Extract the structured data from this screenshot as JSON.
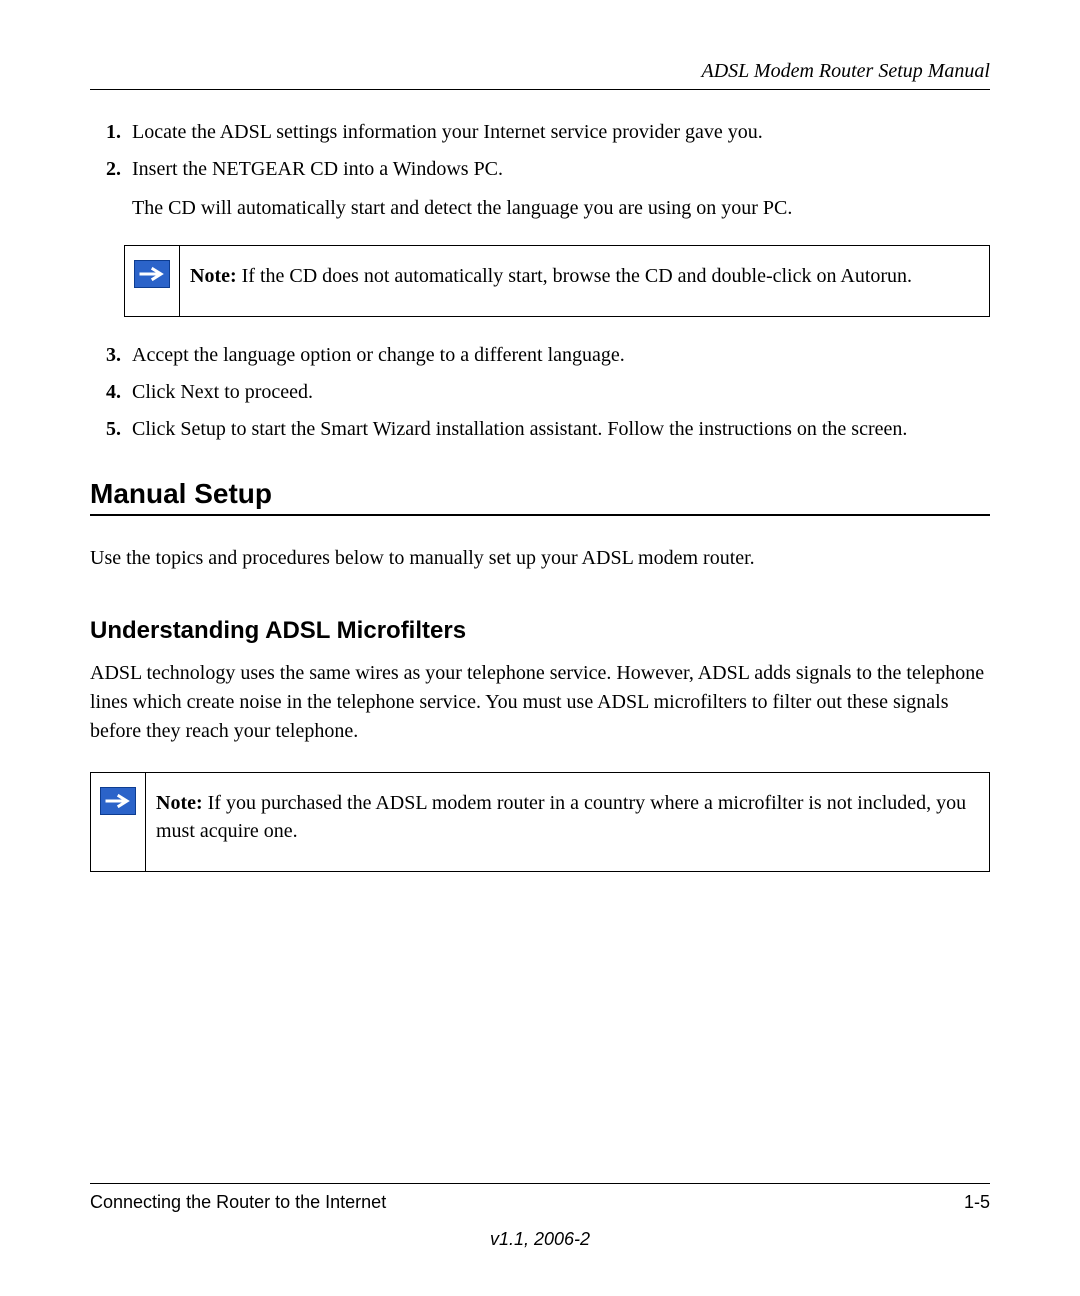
{
  "header": {
    "title": "ADSL Modem Router Setup Manual"
  },
  "steps_a": [
    {
      "num": "1.",
      "text": "Locate the ADSL settings information your Internet service provider gave you."
    },
    {
      "num": "2.",
      "text": "Insert the NETGEAR CD into a Windows PC.",
      "sub": "The CD will automatically start and detect the language you are using on your PC."
    }
  ],
  "note1": {
    "label": "Note: ",
    "text": "If the CD does not automatically start, browse the CD and double-click on Autorun."
  },
  "steps_b": [
    {
      "num": "3.",
      "text": "Accept the language option or change to a different language."
    },
    {
      "num": "4.",
      "text": "Click Next to proceed."
    },
    {
      "num": "5.",
      "text": "Click Setup to start the Smart Wizard installation assistant. Follow the instructions on the screen."
    }
  ],
  "section": {
    "title": "Manual Setup",
    "intro": "Use the topics and procedures below to manually set up your ADSL modem router."
  },
  "subsection": {
    "title": "Understanding ADSL Microfilters",
    "body": "ADSL technology uses the same wires as your telephone service. However, ADSL adds signals to the telephone lines which create noise in the telephone service. You must use ADSL microfilters to filter out these signals before they reach your telephone."
  },
  "note2": {
    "label": "Note: ",
    "text": "If you purchased the ADSL modem router in a country where a microfilter is not included, you must acquire one."
  },
  "footer": {
    "chapter": "Connecting the Router to the Internet",
    "page": "1-5",
    "version": "v1.1, 2006-2"
  }
}
